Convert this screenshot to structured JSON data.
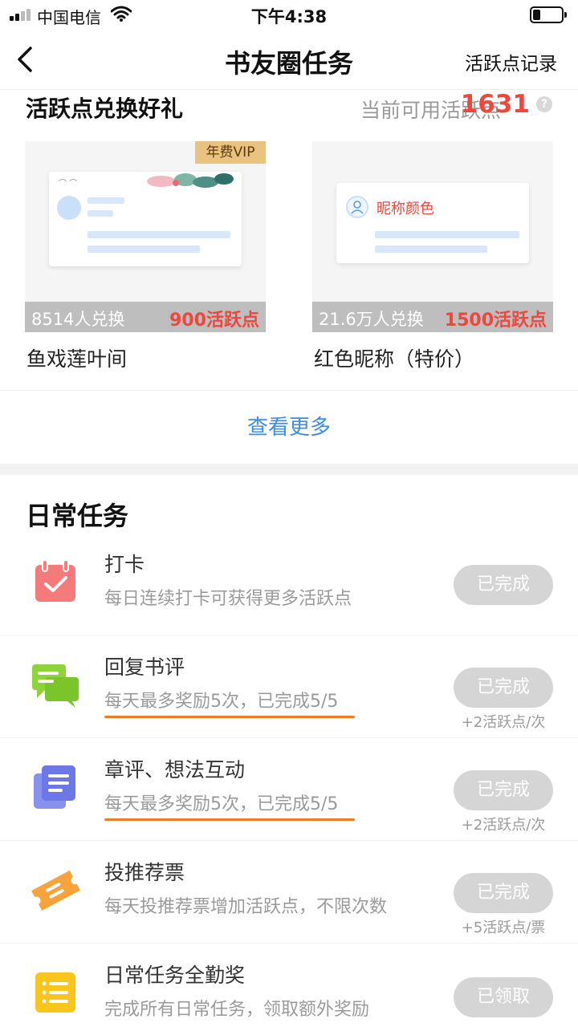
{
  "status_bar": {
    "carrier": "中国电信",
    "time": "下午4:38"
  },
  "nav": {
    "title": "书友圈任务",
    "right_label": "活跃点记录"
  },
  "gift_section": {
    "title": "活跃点兑换好礼",
    "points_label": "当前可用活跃点",
    "points_value": "1631",
    "help_glyph": "?",
    "items": [
      {
        "badge": "年费VIP",
        "count": "8514人兑换",
        "cost": "900活跃点",
        "name": "鱼戏莲叶间"
      },
      {
        "preview_text": "昵称颜色",
        "count": "21.6万人兑换",
        "cost": "1500活跃点",
        "name": "红色昵称（特价）"
      }
    ],
    "more_label": "查看更多"
  },
  "daily": {
    "title": "日常任务",
    "tasks": [
      {
        "icon": "calendar-check-icon",
        "name": "打卡",
        "desc": "每日连续打卡可获得更多活跃点",
        "button": "已完成",
        "reward": ""
      },
      {
        "icon": "chat-bubbles-icon",
        "name": "回复书评",
        "desc": "每天最多奖励5次，已完成5/5",
        "button": "已完成",
        "reward": "+2活跃点/次"
      },
      {
        "icon": "document-stack-icon",
        "name": "章评、想法互动",
        "desc": "每天最多奖励5次，已完成5/5",
        "button": "已完成",
        "reward": "+2活跃点/次"
      },
      {
        "icon": "ticket-icon",
        "name": "投推荐票",
        "desc": "每天投推荐票增加活跃点，不限次数",
        "button": "已完成",
        "reward": "+5活跃点/票"
      },
      {
        "icon": "list-icon",
        "name": "日常任务全勤奖",
        "desc": "完成所有日常任务，领取额外奖励",
        "button": "已领取",
        "reward": ""
      }
    ]
  },
  "colors": {
    "accent_red": "#f0463b",
    "link_blue": "#3a8ee6",
    "underline_orange": "#ef7b22",
    "vip_gold": "#e9c27f"
  }
}
